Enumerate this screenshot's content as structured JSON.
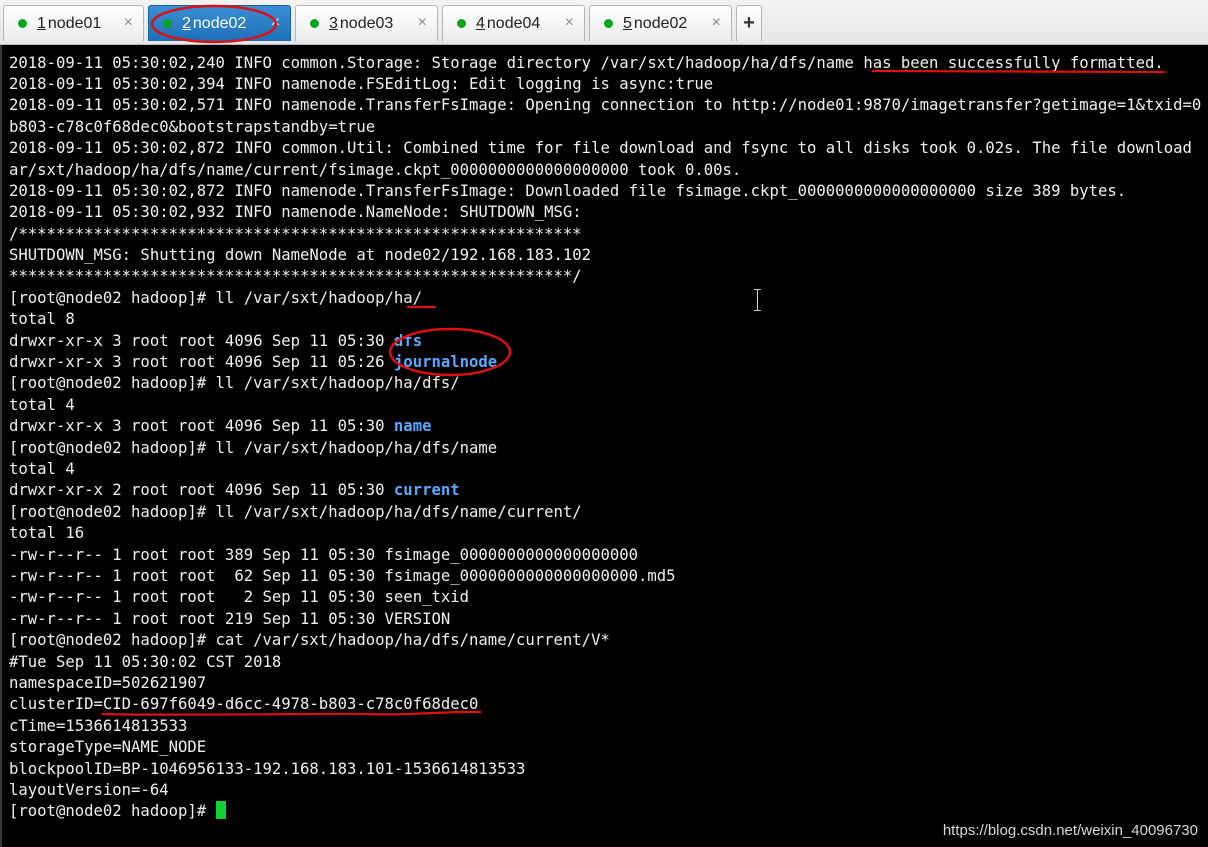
{
  "tabs": [
    {
      "num": "1",
      "label": " node01",
      "close": "×",
      "active": false
    },
    {
      "num": "2",
      "label": " node02",
      "close": "×",
      "active": true
    },
    {
      "num": "3",
      "label": " node03",
      "close": "×",
      "active": false
    },
    {
      "num": "4",
      "label": " node04",
      "close": "×",
      "active": false
    },
    {
      "num": "5",
      "label": " node02",
      "close": "×",
      "active": false
    }
  ],
  "new_tab_label": "+",
  "colors": {
    "status_dot": "#0aa51c",
    "active_tab": "#2a7fc9",
    "directory": "#5aa9ff",
    "annotation": "#e01010",
    "cursor": "#12d12a"
  },
  "terminal": {
    "lines": [
      "2018-09-11 05:30:02,240 INFO common.Storage: Storage directory /var/sxt/hadoop/ha/dfs/name has been successfully formatted.",
      "2018-09-11 05:30:02,394 INFO namenode.FSEditLog: Edit logging is async:true",
      "2018-09-11 05:30:02,571 INFO namenode.TransferFsImage: Opening connection to http://node01:9870/imagetransfer?getimage=1&txid=0",
      "b803-c78c0f68dec0&bootstrapstandby=true",
      "2018-09-11 05:30:02,872 INFO common.Util: Combined time for file download and fsync to all disks took 0.02s. The file download",
      "ar/sxt/hadoop/ha/dfs/name/current/fsimage.ckpt_0000000000000000000 took 0.00s.",
      "2018-09-11 05:30:02,872 INFO namenode.TransferFsImage: Downloaded file fsimage.ckpt_0000000000000000000 size 389 bytes.",
      "2018-09-11 05:30:02,932 INFO namenode.NameNode: SHUTDOWN_MSG:",
      "/************************************************************",
      "SHUTDOWN_MSG: Shutting down NameNode at node02/192.168.183.102",
      "************************************************************/",
      "[root@node02 hadoop]# ll /var/sxt/hadoop/ha/",
      "total 8",
      "drwxr-xr-x 3 root root 4096 Sep 11 05:30 ",
      "drwxr-xr-x 3 root root 4096 Sep 11 05:26 ",
      "[root@node02 hadoop]# ll /var/sxt/hadoop/ha/dfs/",
      "total 4",
      "drwxr-xr-x 3 root root 4096 Sep 11 05:30 ",
      "[root@node02 hadoop]# ll /var/sxt/hadoop/ha/dfs/name",
      "total 4",
      "drwxr-xr-x 2 root root 4096 Sep 11 05:30 ",
      "[root@node02 hadoop]# ll /var/sxt/hadoop/ha/dfs/name/current/",
      "total 16",
      "-rw-r--r-- 1 root root 389 Sep 11 05:30 fsimage_0000000000000000000",
      "-rw-r--r-- 1 root root  62 Sep 11 05:30 fsimage_0000000000000000000.md5",
      "-rw-r--r-- 1 root root   2 Sep 11 05:30 seen_txid",
      "-rw-r--r-- 1 root root 219 Sep 11 05:30 VERSION",
      "[root@node02 hadoop]# cat /var/sxt/hadoop/ha/dfs/name/current/V*",
      "#Tue Sep 11 05:30:02 CST 2018",
      "namespaceID=502621907",
      "clusterID=CID-697f6049-d6cc-4978-b803-c78c0f68dec0",
      "cTime=1536614813533",
      "storageType=NAME_NODE",
      "blockpoolID=BP-1046956133-192.168.183.101-1536614813533",
      "layoutVersion=-64",
      "[root@node02 hadoop]# "
    ],
    "dir_names": {
      "13": "dfs",
      "14": "journalnode",
      "17": "name",
      "20": "current"
    }
  },
  "watermark": "https://blog.csdn.net/weixin_40096730"
}
